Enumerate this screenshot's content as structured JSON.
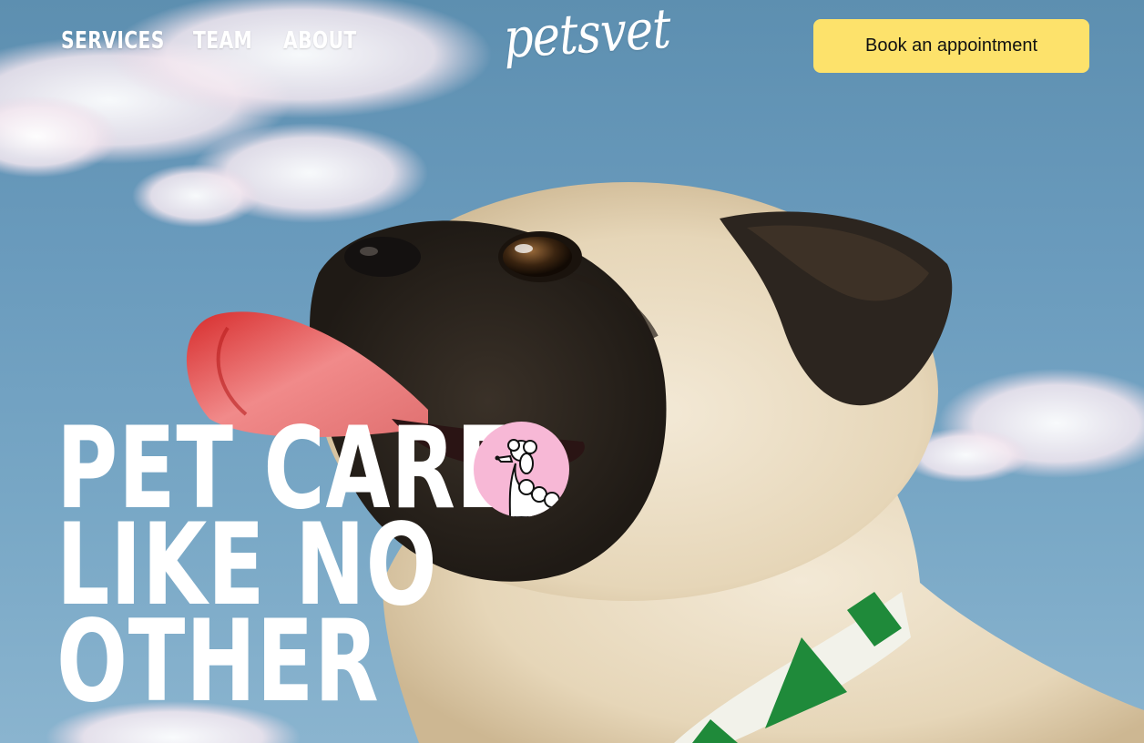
{
  "nav": {
    "links": [
      {
        "label": "SERVICES"
      },
      {
        "label": "TEAM"
      },
      {
        "label": "ABOUT"
      }
    ],
    "logo": "petsvet",
    "cta_label": "Book an appointment"
  },
  "hero": {
    "headline_lines": [
      "PET CARE",
      "LIKE NO",
      "OTHER"
    ],
    "image_icon": "pug-photo",
    "badge_icon": "poodle-icon"
  },
  "colors": {
    "cta_background": "#fde26b",
    "badge_background": "#f7b8d6",
    "text": "#ffffff"
  }
}
